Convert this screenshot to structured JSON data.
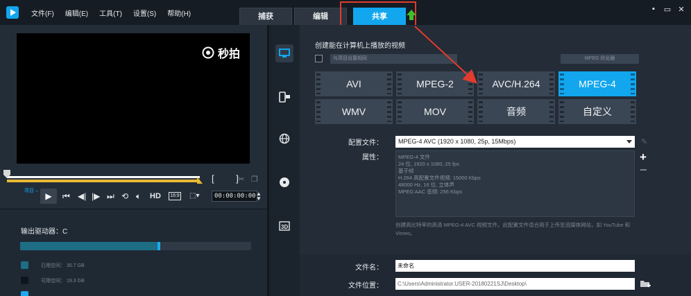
{
  "menu": [
    "文件(F)",
    "编辑(E)",
    "工具(T)",
    "设置(S)",
    "帮助(H)"
  ],
  "tabs": {
    "capture": "捕获",
    "edit": "编辑",
    "share": "共享"
  },
  "window": {
    "minimize": "▪",
    "restore": "▭",
    "close": "✕"
  },
  "preview": {
    "watermark": "秒拍",
    "project_label": "项目 –",
    "hd": "HD",
    "ratio": "16:9",
    "timecode": "00:00:00:00",
    "brackets": "[ ]"
  },
  "drive": {
    "label": "输出驱动器：C",
    "used_fraction": 0.6,
    "legend": [
      {
        "label": "已用空间：",
        "value": "30.7 GB",
        "color": "#1d6d85"
      },
      {
        "label": "可用空间：",
        "value": "19.3 GB",
        "color": "#0e151c"
      },
      {
        "label": "",
        "value": "",
        "color": "#19aaf0"
      }
    ]
  },
  "share": {
    "title": "创建能在计算机上播放的视频",
    "filter_placeholder": "与项目设置相同",
    "mpeg_option": "MPEG 优化器",
    "formats": [
      "AVI",
      "MPEG-2",
      "AVC/H.264",
      "MPEG-4",
      "WMV",
      "MOV",
      "音频",
      "自定义"
    ],
    "selected_format": "MPEG-4",
    "profile_label": "配置文件：",
    "profile_value": "MPEG-4 AVC (1920 x 1080, 25p, 15Mbps)",
    "props_label": "属性：",
    "props": [
      "MPEG-4 文件",
      "24 位, 1920 x 1080, 25 fps",
      "基于帧",
      "H.264 高配置文件视频: 15000 Kbps",
      "48000 Hz, 16 位, 立体声",
      "MPEG AAC 音频: 256 Kbps"
    ],
    "description": "创建高比特率的高清 MPEG-4 AVC 视频文件。此配置文件适合用于上传至流媒体网站，如 YouTube 和 Vimeo。",
    "filename_label": "文件名：",
    "filename_value": "未命名",
    "filelocation_label": "文件位置：",
    "filelocation_value": "C:\\Users\\Administrator.USER-20180221SJ\\Desktop\\"
  },
  "colors": {
    "accent": "#12a6ee",
    "highlight": "#e33b2e"
  }
}
